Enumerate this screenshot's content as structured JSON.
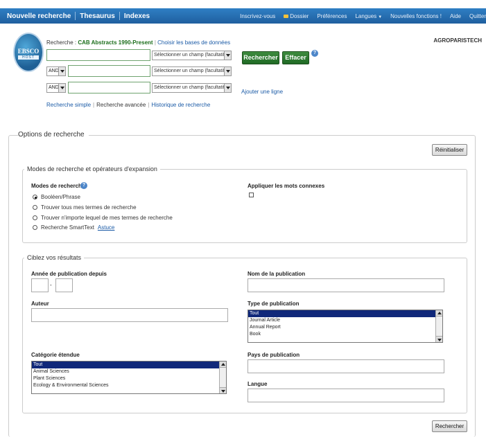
{
  "topnav": {
    "left": [
      "Nouvelle recherche",
      "Thesaurus",
      "Indexes"
    ],
    "right": {
      "signin": "Inscrivez-vous",
      "folder": "Dossier",
      "preferences": "Préférences",
      "languages": "Langues",
      "new_features": "Nouvelles fonctions !",
      "help": "Aide",
      "exit": "Quitter"
    }
  },
  "logo": {
    "line1": "EBSCO",
    "line2": "HOST"
  },
  "institution": "AGROPARISTECH",
  "search": {
    "label": "Recherche :",
    "database": "CAB Abstracts 1990-Present",
    "choose_db": "Choisir les bases de données",
    "field_placeholder": "Sélectionner un champ (facultatif)",
    "operator": "AND",
    "search_button": "Rechercher",
    "clear_button": "Effacer",
    "add_line": "Ajouter une ligne",
    "links": [
      "Recherche simple",
      "Recherche avancée",
      "Historique de recherche"
    ]
  },
  "options": {
    "title": "Options de recherche",
    "reset_button": "Réinitialiser",
    "modes_section": "Modes de recherche et opérateurs d'expansion",
    "modes_label": "Modes de recherche",
    "modes": [
      {
        "label": "Booléen/Phrase",
        "selected": true
      },
      {
        "label": "Trouver tous mes termes de recherche",
        "selected": false
      },
      {
        "label": "Trouver n'importe lequel de mes termes de recherche",
        "selected": false
      },
      {
        "label": "Recherche SmartText",
        "selected": false
      }
    ],
    "smarttext_tip": "Astuce",
    "related_words_label": "Appliquer les mots connexes",
    "refine_section": "Ciblez vos résultats",
    "pub_year_label": "Année de publication depuis",
    "year_dash": "-",
    "author_label": "Auteur",
    "broad_category_label": "Catégorie étendue",
    "broad_category_options": [
      "Tout",
      "Animal Sciences",
      "Plant Sciences",
      "Ecology & Environmental Sciences"
    ],
    "pub_name_label": "Nom de la publication",
    "pub_type_label": "Type de publication",
    "pub_type_options": [
      "Tout",
      "Journal Article",
      "Annual Report",
      "Book"
    ],
    "pub_country_label": "Pays de publication",
    "language_label": "Langue",
    "bottom_search_button": "Rechercher"
  }
}
